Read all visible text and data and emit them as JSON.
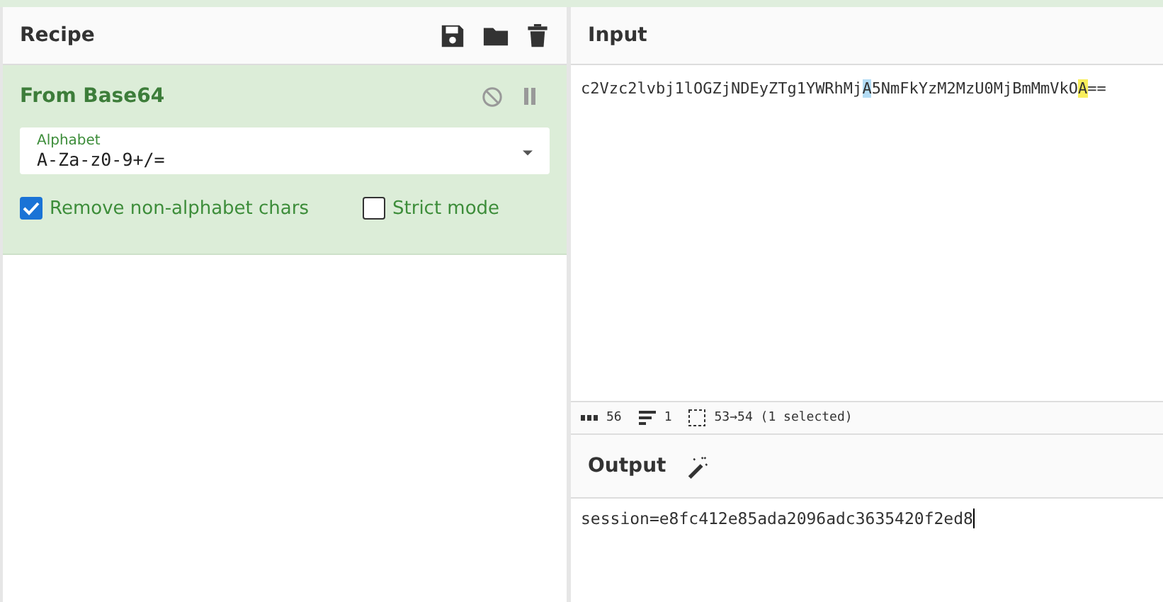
{
  "recipe": {
    "title": "Recipe",
    "operations": [
      {
        "name": "From Base64",
        "disabled": false,
        "paused": false,
        "fields": [
          {
            "label": "Alphabet",
            "value": "A-Za-z0-9+/="
          }
        ],
        "options": [
          {
            "label": "Remove non-alphabet chars",
            "checked": true
          },
          {
            "label": "Strict mode",
            "checked": false
          }
        ]
      }
    ]
  },
  "input": {
    "title": "Input",
    "segments": [
      {
        "text": "c2Vzc2lvbj1lOGZjNDEyZTg1YWRhMj",
        "kind": "plain"
      },
      {
        "text": "A",
        "kind": "match"
      },
      {
        "text": "5NmFkYzM2MzU0MjBmMmVkO",
        "kind": "plain"
      },
      {
        "text": "A",
        "kind": "selection"
      },
      {
        "text": "==",
        "kind": "plain"
      }
    ]
  },
  "status_bar": {
    "length": "56",
    "lines": "1",
    "selection": "53→54 (1 selected)"
  },
  "output": {
    "title": "Output",
    "text": "session=e8fc412e85ada2096adc3635420f2ed8"
  }
}
